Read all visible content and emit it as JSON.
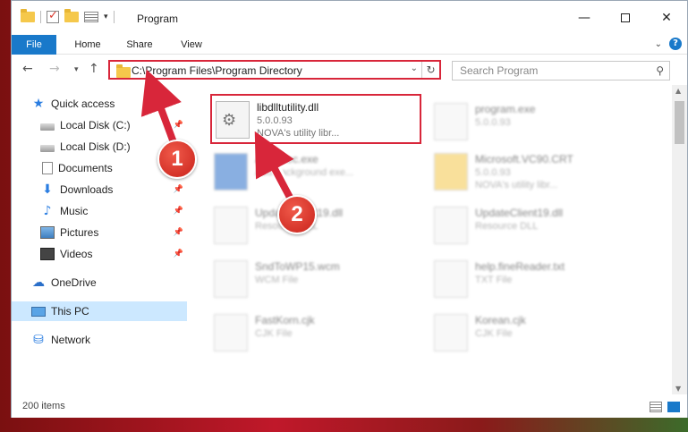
{
  "window": {
    "title": "Program"
  },
  "ribbon": {
    "tabs": [
      "File",
      "Home",
      "Share",
      "View"
    ]
  },
  "address": {
    "path": "C:\\Program Files\\Program Directory"
  },
  "search": {
    "placeholder": "Search Program"
  },
  "sidebar": {
    "items": [
      {
        "label": "Quick access",
        "icon": "star-icon"
      },
      {
        "label": "Local Disk (C:)",
        "icon": "disk-icon"
      },
      {
        "label": "Local Disk (D:)",
        "icon": "disk-icon"
      },
      {
        "label": "Documents",
        "icon": "documents-icon"
      },
      {
        "label": "Downloads",
        "icon": "download-icon"
      },
      {
        "label": "Music",
        "icon": "music-icon"
      },
      {
        "label": "Pictures",
        "icon": "pictures-icon"
      },
      {
        "label": "Videos",
        "icon": "videos-icon"
      },
      {
        "label": "OneDrive",
        "icon": "cloud-icon"
      },
      {
        "label": "This PC",
        "icon": "pc-icon"
      },
      {
        "label": "Network",
        "icon": "network-icon"
      }
    ]
  },
  "files": [
    {
      "name": "libdlltutility.dll",
      "line1": "5.0.0.93",
      "line2": "NOVA's utility libr..."
    },
    {
      "name": "program.exe",
      "line1": "5.0.0.93",
      "line2": ""
    },
    {
      "name": "AppExec.exe",
      "line1": "Add background exe...",
      "line2": ""
    },
    {
      "name": "Microsoft.VC90.CRT",
      "line1": "5.0.0.93",
      "line2": "NOVA's utility libr..."
    },
    {
      "name": "UpdateClient19.dll",
      "line1": "Resource DLL",
      "line2": ""
    },
    {
      "name": "UpdateClient19.dll",
      "line1": "Resource DLL",
      "line2": ""
    },
    {
      "name": "SndToWP15.wcm",
      "line1": "WCM File",
      "line2": ""
    },
    {
      "name": "help.fineReader.txt",
      "line1": "TXT File",
      "line2": ""
    },
    {
      "name": "FastKorn.cjk",
      "line1": "CJK File",
      "line2": ""
    },
    {
      "name": "Korean.cjk",
      "line1": "CJK File",
      "line2": ""
    }
  ],
  "status": {
    "count": "200 items"
  },
  "annotations": {
    "marker1": "1",
    "marker2": "2"
  },
  "colors": {
    "accent": "#1979ca",
    "highlight": "#d8263a",
    "selected_nav": "#cce8ff"
  }
}
